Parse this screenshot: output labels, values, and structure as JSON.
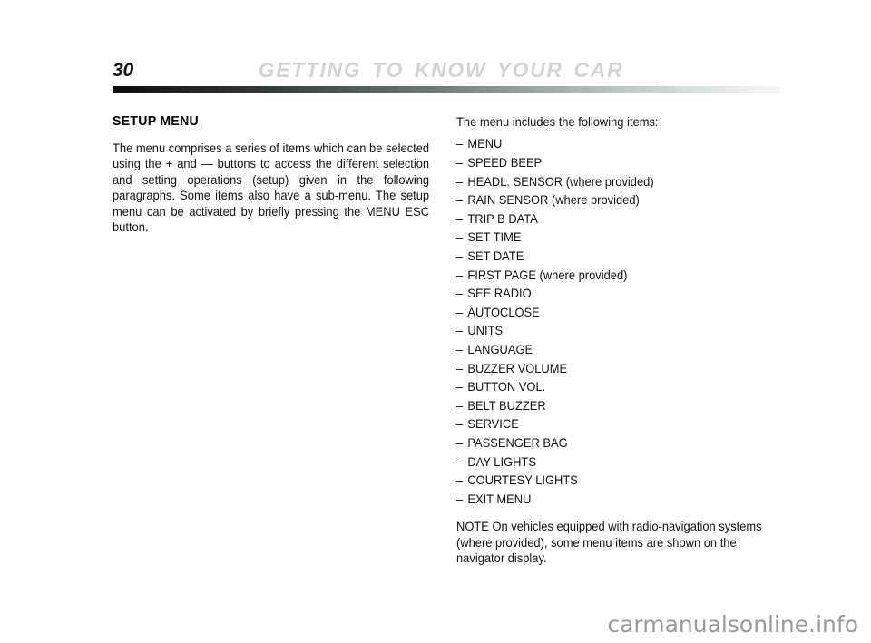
{
  "header": {
    "page_number": "30",
    "title": "GETTING TO KNOW YOUR CAR"
  },
  "left_column": {
    "heading": "SETUP MENU",
    "paragraph": "The menu comprises a series of items which can be selected using the + and — buttons to access the different selection and setting operations (setup) given in the following paragraphs. Some items also have a sub-menu. The setup menu can be activated by briefly pressing the MENU ESC button."
  },
  "right_column": {
    "intro": "The menu includes the following items:",
    "dash": "–",
    "items": [
      {
        "label": "MENU",
        "suffix": ""
      },
      {
        "label": "SPEED BEEP",
        "suffix": ""
      },
      {
        "label": "HEADL. SENSOR",
        "suffix": " (where provided)"
      },
      {
        "label": "RAIN SENSOR",
        "suffix": " (where provided)"
      },
      {
        "label": "TRIP B DATA",
        "suffix": ""
      },
      {
        "label": "SET TIME",
        "suffix": ""
      },
      {
        "label": "SET DATE",
        "suffix": ""
      },
      {
        "label": "FIRST PAGE",
        "suffix": " (where provided)"
      },
      {
        "label": "SEE RADIO",
        "suffix": ""
      },
      {
        "label": "AUTOCLOSE",
        "suffix": ""
      },
      {
        "label": "UNITS",
        "suffix": ""
      },
      {
        "label": "LANGUAGE",
        "suffix": ""
      },
      {
        "label": "BUZZER VOLUME",
        "suffix": ""
      },
      {
        "label": "BUTTON VOL.",
        "suffix": ""
      },
      {
        "label": "BELT BUZZER",
        "suffix": ""
      },
      {
        "label": "SERVICE",
        "suffix": ""
      },
      {
        "label": "PASSENGER BAG",
        "suffix": ""
      },
      {
        "label": "DAY LIGHTS",
        "suffix": ""
      },
      {
        "label": "COURTESY LIGHTS",
        "suffix": ""
      },
      {
        "label": "EXIT MENU",
        "suffix": ""
      }
    ],
    "note": "NOTE On vehicles equipped with radio-navigation systems (where provided), some menu items are shown on the navigator display."
  },
  "watermark": {
    "text": "carmanualsonline.info"
  },
  "colors": {
    "text": "#121212",
    "header_title": "#d2d4d6",
    "rule_dark": "#0a0c0d",
    "rule_light": "#f4f7f8",
    "watermark": "#9a9a9a",
    "background": "#ffffff"
  }
}
